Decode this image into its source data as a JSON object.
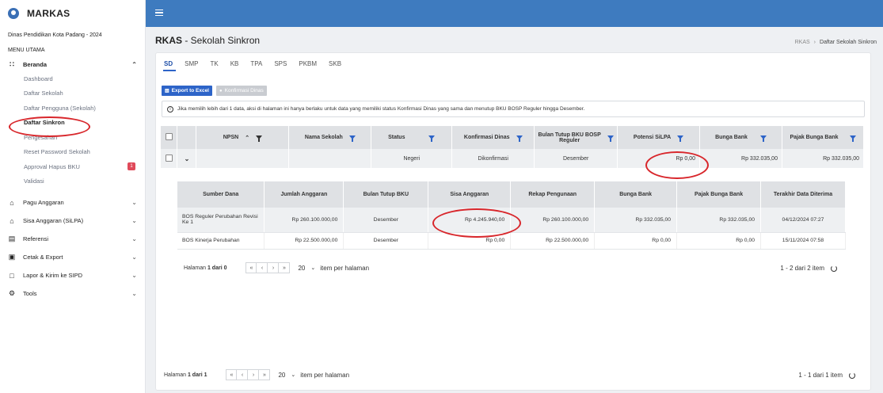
{
  "brand": {
    "name": "MARKAS"
  },
  "sidebar": {
    "org": "Dinas Pendidikan Kota Padang - 2024",
    "menu_heading": "MENU UTAMA",
    "beranda": {
      "label": "Beranda",
      "items": [
        {
          "label": "Dashboard"
        },
        {
          "label": "Daftar Sekolah"
        },
        {
          "label": "Daftar Pengguna (Sekolah)"
        },
        {
          "label": "Daftar Sinkron"
        },
        {
          "label": "Pengesahan"
        },
        {
          "label": "Reset Password Sekolah"
        },
        {
          "label": "Approval Hapus BKU",
          "badge": "1"
        },
        {
          "label": "Validasi"
        }
      ]
    },
    "groups": [
      {
        "label": "Pagu Anggaran"
      },
      {
        "label": "Sisa Anggaran (SiLPA)"
      },
      {
        "label": "Referensi"
      },
      {
        "label": "Cetak & Export"
      },
      {
        "label": "Lapor & Kirim ke SIPD"
      },
      {
        "label": "Tools"
      }
    ]
  },
  "page": {
    "title_bold": "RKAS",
    "title_rest": " - Sekolah Sinkron",
    "breadcrumb": [
      "RKAS",
      "Daftar Sekolah Sinkron"
    ]
  },
  "tabs": [
    "SD",
    "SMP",
    "TK",
    "KB",
    "TPA",
    "SPS",
    "PKBM",
    "SKB"
  ],
  "buttons": {
    "export": "Export to Excel",
    "konfirmasi": "Konfirmasi Dinas"
  },
  "info_text": "Jika memilih lebih dari 1 data, aksi di halaman ini hanya berlaku untuk data yang memiliki status Konfirmasi Dinas yang sama dan menutup BKU BOSP Reguler hingga Desember.",
  "outer_table": {
    "headers": [
      "NPSN",
      "Nama Sekolah",
      "Status",
      "Konfirmasi Dinas",
      "Bulan Tutup BKU BOSP Reguler",
      "Potensi SiLPA",
      "Bunga Bank",
      "Pajak Bunga Bank"
    ],
    "row": {
      "npsn": "",
      "nama": "",
      "status": "Negeri",
      "konfirmasi": "Dikonfirmasi",
      "bulan": "Desember",
      "silpa": "Rp 0,00",
      "bunga": "Rp 332.035,00",
      "pajak": "Rp 332.035,00"
    }
  },
  "inner_table": {
    "headers": [
      "Sumber Dana",
      "Jumlah Anggaran",
      "Bulan Tutup BKU",
      "Sisa Anggaran",
      "Rekap Pengunaan",
      "Bunga Bank",
      "Pajak Bunga Bank",
      "Terakhir Data Diterima"
    ],
    "rows": [
      {
        "sumber": "BOS Reguler Perubahan Revisi Ke 1",
        "jumlah": "Rp 260.100.000,00",
        "bulan": "Desember",
        "sisa": "Rp 4.245.940,00",
        "rekap": "Rp 260.100.000,00",
        "bunga": "Rp 332.035,00",
        "pajak": "Rp 332.035,00",
        "terakhir": "04/12/2024 07:27"
      },
      {
        "sumber": "BOS Kinerja Perubahan",
        "jumlah": "Rp 22.500.000,00",
        "bulan": "Desember",
        "sisa": "Rp 0,00",
        "rekap": "Rp 22.500.000,00",
        "bunga": "Rp 0,00",
        "pajak": "Rp 0,00",
        "terakhir": "15/11/2024 07:58"
      }
    ]
  },
  "inner_pager": {
    "page_label": "Halaman",
    "page_value": "1 dari 0",
    "per_page": "20",
    "per_page_label": "item per halaman",
    "summary": "1 - 2 dari 2 item"
  },
  "outer_pager": {
    "page_label": "Halaman",
    "page_value": "1 dari 1",
    "per_page": "20",
    "per_page_label": "item per halaman",
    "summary": "1 - 1 dari 1 item"
  },
  "colors": {
    "topbar": "#3e7bbf",
    "primary": "#2d64c8",
    "annotation": "#d8262b",
    "badge": "#e04a5a"
  }
}
